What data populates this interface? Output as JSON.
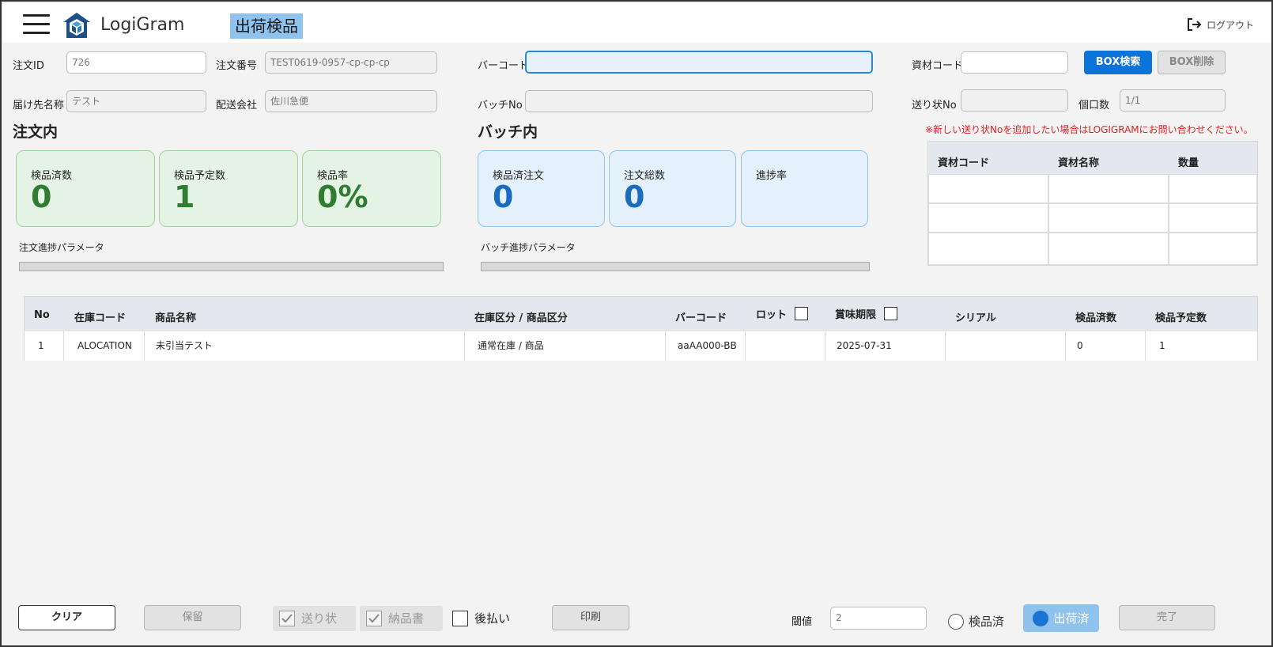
{
  "header": {
    "app_name": "LogiGram",
    "page_title": "出荷検品",
    "logout_label": "ログアウト"
  },
  "form": {
    "order_id": {
      "label": "注文ID",
      "value": "726"
    },
    "order_number": {
      "label": "注文番号",
      "value": "TEST0619-0957-cp-cp-cp"
    },
    "barcode": {
      "label": "バーコード",
      "value": ""
    },
    "material_code": {
      "label": "資材コード",
      "value": ""
    },
    "recipient_name": {
      "label": "届け先名称",
      "value": "テスト"
    },
    "delivery_company": {
      "label": "配送会社",
      "value": "佐川急便"
    },
    "batch_no": {
      "label": "バッチNo",
      "value": ""
    },
    "invoice_no": {
      "label": "送り状No",
      "value": ""
    },
    "package_count": {
      "label": "個口数",
      "value": "1/1"
    },
    "box_search_label": "BOX検索",
    "box_delete_label": "BOX削除"
  },
  "notice": "※新しい送り状Noを追加したい場合はLOGIGRAMにお問い合わせください。",
  "order_section": {
    "title": "注文内",
    "cards": [
      {
        "label": "検品済数",
        "value": "0"
      },
      {
        "label": "検品予定数",
        "value": "1"
      },
      {
        "label": "検品率",
        "value": "0%"
      }
    ],
    "param_label": "注文進捗パラメータ",
    "progress": 0
  },
  "batch_section": {
    "title": "バッチ内",
    "cards": [
      {
        "label": "検品済注文",
        "value": "0"
      },
      {
        "label": "注文総数",
        "value": "0"
      },
      {
        "label": "進捗率",
        "value": ""
      }
    ],
    "param_label": "バッチ進捗パラメータ",
    "progress": 0
  },
  "material_table": {
    "headers": [
      "資材コード",
      "資材名称",
      "数量"
    ]
  },
  "items_table": {
    "headers": [
      "No",
      "在庫コード",
      "商品名称",
      "在庫区分 / 商品区分",
      "バーコード",
      "ロット",
      "賞味期限",
      "シリアル",
      "検品済数",
      "検品予定数"
    ],
    "rows": [
      {
        "no": "1",
        "stock_code": "ALOCATION",
        "product_name": "未引当テスト",
        "category": "通常在庫 / 商品",
        "barcode": "aaAA000-BB",
        "lot": "",
        "expiry": "2025-07-31",
        "serial": "",
        "inspected": "0",
        "planned": "1"
      }
    ]
  },
  "footer": {
    "clear_label": "クリア",
    "hold_label": "保留",
    "invoice_chk_label": "送り状",
    "delivery_note_chk_label": "納品書",
    "deferred_pay_label": "後払い",
    "print_label": "印刷",
    "threshold_label": "閾値",
    "threshold_value": "2",
    "inspected_radio_label": "検品済",
    "shipped_label": "出荷済",
    "complete_label": "完了"
  },
  "colors": {
    "accent": "#0a74da",
    "title_bg": "#8fc2ec",
    "green_card": "#e5f3e4",
    "blue_card": "#e4f0fb",
    "notice_red": "#e02020"
  }
}
